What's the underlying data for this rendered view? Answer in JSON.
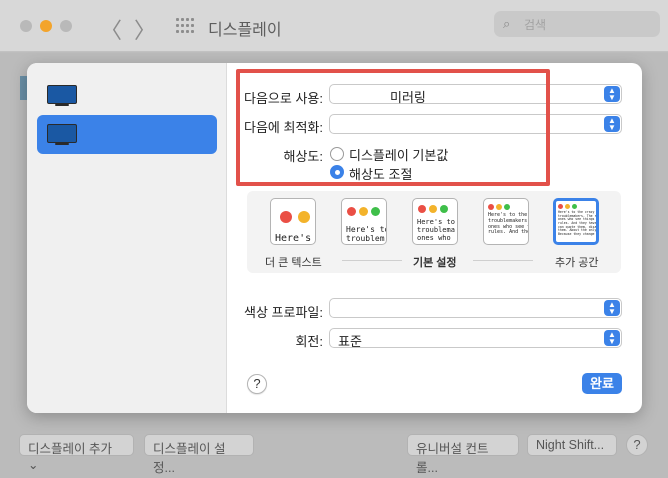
{
  "window": {
    "title": "디스플레이",
    "search_placeholder": "검색",
    "nav_back": "〈",
    "nav_forward": "〉"
  },
  "bottom_bar": {
    "add_display": "디스플레이 추가 ⌄",
    "display_settings": "디스플레이 설정...",
    "universal_control": "유니버설 컨트롤...",
    "night_shift": "Night Shift...",
    "help": "?"
  },
  "sheet": {
    "use_as": {
      "label": "다음으로 사용:",
      "value": "미러링"
    },
    "optimize_for": {
      "label": "다음에 최적화:",
      "value": ""
    },
    "resolution": {
      "label": "해상도:",
      "options": [
        {
          "label": "디스플레이 기본값",
          "selected": false
        },
        {
          "label": "해상도 조절",
          "selected": true
        }
      ]
    },
    "scale": {
      "thumbnails": [
        {
          "text": "Here's",
          "selected": false
        },
        {
          "text": "Here's to\ntroublem",
          "selected": false
        },
        {
          "text": "Here's to t\ntroublema\nones who",
          "selected": false
        },
        {
          "text": "Here's to the cr\ntroublemakers.\nones who see th\nrules. And they",
          "selected": false
        },
        {
          "text": "Here's to the crazy ones\ntroublemakers. The round\nones who see things diff\nrules. And they have no\ncan quote them, disagre\nthem. About the only thin\nBecause they change thi",
          "selected": true
        }
      ],
      "labels": {
        "larger": "더 큰 텍스트",
        "default": "기본 설정",
        "more_space": "추가 공간"
      }
    },
    "color_profile": {
      "label": "색상 프로파일:",
      "value": ""
    },
    "rotation": {
      "label": "회전:",
      "value": "표준"
    },
    "help": "?",
    "done": "완료"
  },
  "colors": {
    "accent": "#3b82e8",
    "highlight_border": "#e2514a",
    "display_icon": "#1a58a3"
  }
}
